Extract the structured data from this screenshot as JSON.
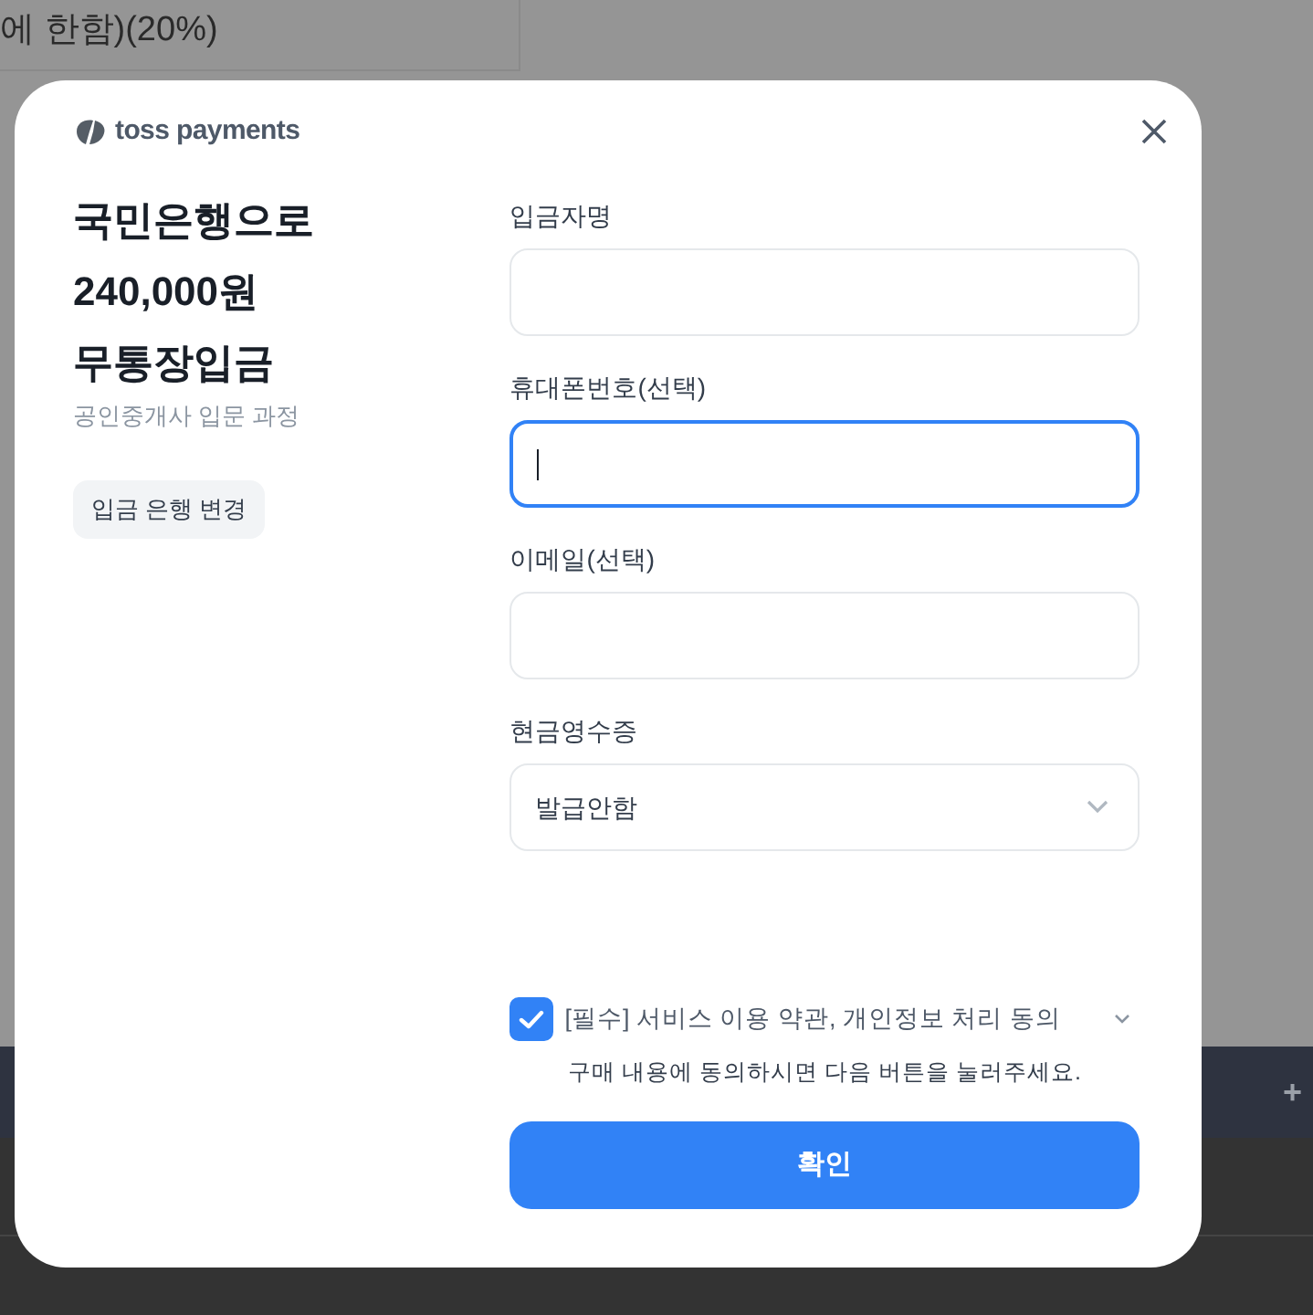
{
  "background": {
    "top_cell": "에 한함)(20%)",
    "bar_button": "+"
  },
  "dialog": {
    "brand": "toss payments",
    "title_lines": [
      "국민은행으로",
      "240,000원",
      "무통장입금"
    ],
    "subtitle": "공인중개사 입문 과정",
    "change_bank_button": "입금 은행 변경",
    "fields": [
      {
        "kind": "input",
        "label": "입금자명",
        "focused": false
      },
      {
        "kind": "input",
        "label": "휴대폰번호(선택)",
        "focused": true
      },
      {
        "kind": "input",
        "label": "이메일(선택)",
        "focused": false
      },
      {
        "kind": "select",
        "label": "현금영수증",
        "value": "발급안함",
        "focused": false
      }
    ],
    "agreement": {
      "checked": true,
      "label": "[필수] 서비스 이용 약관, 개인정보 처리 동의"
    },
    "notice": "구매 내용에 동의하시면 다음 버튼을 눌러주세요.",
    "confirm_button": "확인"
  }
}
